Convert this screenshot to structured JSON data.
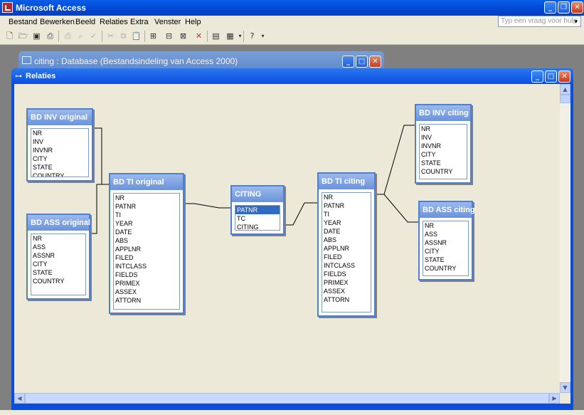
{
  "app": {
    "title": "Microsoft Access",
    "help_placeholder": "Typ een vraag voor hulp",
    "help_arrow_icon": "chevron-down-icon"
  },
  "menu": [
    "Bestand",
    "Bewerken",
    "Beeld",
    "Relaties",
    "Extra",
    "Venster",
    "Help"
  ],
  "toolbar_icons": [
    "new-icon",
    "open-icon",
    "save-icon",
    "print-preview-icon",
    "print-icon",
    "spelling-icon",
    "cut-icon",
    "copy-icon",
    "paste-icon",
    "show-table-icon",
    "show-direct-icon",
    "show-all-icon",
    "delete-icon",
    "new-object-icon",
    "help-icon"
  ],
  "db_window": {
    "title": "citing : Database (Bestandsindeling van Access 2000)"
  },
  "relations_window": {
    "title": "Relaties"
  },
  "tables": [
    {
      "id": "bd-inv-original",
      "title": "BD INV original",
      "fields": [
        "NR",
        "INV",
        "INVNR",
        "CITY",
        "STATE",
        "COUNTRY"
      ]
    },
    {
      "id": "bd-ass-original",
      "title": "BD ASS original",
      "fields": [
        "NR",
        "ASS",
        "ASSNR",
        "CITY",
        "STATE",
        "COUNTRY"
      ]
    },
    {
      "id": "bd-ti-original",
      "title": "BD TI original",
      "fields": [
        "NR",
        "PATNR",
        "TI",
        "YEAR",
        "DATE",
        "ABS",
        "APPLNR",
        "FILED",
        "INTCLASS",
        "FIELDS",
        "PRIMEX",
        "ASSEX",
        "ATTORN"
      ]
    },
    {
      "id": "citing",
      "title": "CITING",
      "fields": [
        "PATNR",
        "TC",
        "CITING"
      ],
      "selected": "PATNR"
    },
    {
      "id": "bd-ti-citing",
      "title": "BD TI citing",
      "fields": [
        "NR",
        "PATNR",
        "TI",
        "YEAR",
        "DATE",
        "ABS",
        "APPLNR",
        "FILED",
        "INTCLASS",
        "FIELDS",
        "PRIMEX",
        "ASSEX",
        "ATTORN"
      ]
    },
    {
      "id": "bd-inv-citing",
      "title": "BD INV citing",
      "fields": [
        "NR",
        "INV",
        "INVNR",
        "CITY",
        "STATE",
        "COUNTRY"
      ]
    },
    {
      "id": "bd-ass-citing",
      "title": "BD ASS citing",
      "fields": [
        "NR",
        "ASS",
        "ASSNR",
        "CITY",
        "STATE",
        "COUNTRY"
      ]
    }
  ],
  "colors": {
    "titlebar": "#0a4ee0",
    "table_header": "#7ea2e0",
    "canvas": "#ece9d8",
    "selection": "#316ac5"
  }
}
